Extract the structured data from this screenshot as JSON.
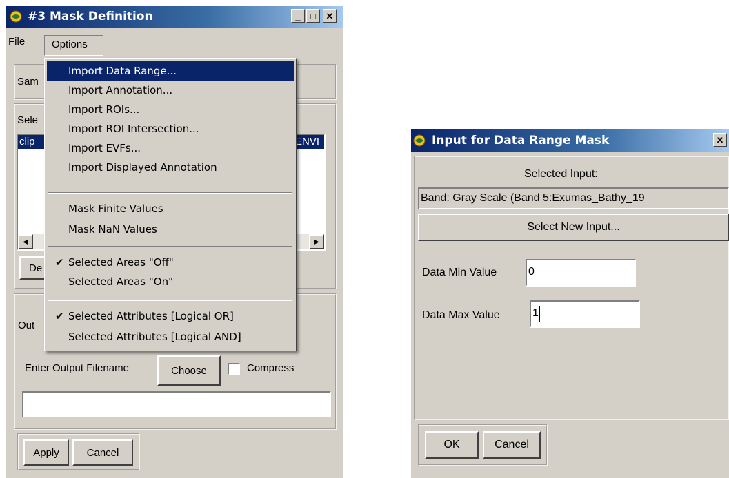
{
  "mask_window": {
    "title": "#3 Mask Definition",
    "menubar": [
      "File",
      "Options"
    ],
    "sample_label": "Sam",
    "select_label": "Sele",
    "list_item": "clip",
    "list_item_right": "ENVI",
    "define_button": "De",
    "output_label": "Out",
    "enter_output_label": "Enter Output Filename",
    "choose_button": "Choose",
    "compress_label": "Compress",
    "output_filename": "",
    "apply_button": "Apply",
    "cancel_button": "Cancel"
  },
  "options_menu": {
    "items": [
      {
        "label": "Import Data Range...",
        "highlighted": true,
        "checked": false
      },
      {
        "label": "Import Annotation...",
        "checked": false
      },
      {
        "label": "Import ROIs...",
        "checked": false
      },
      {
        "label": "Import ROI Intersection...",
        "checked": false
      },
      {
        "label": "Import EVFs...",
        "checked": false
      },
      {
        "label": "Import Displayed Annotation",
        "checked": false
      },
      {
        "label": "Mask Finite Values",
        "checked": false
      },
      {
        "label": "Mask NaN Values",
        "checked": false
      },
      {
        "label": "Selected Areas \"Off\"",
        "checked": true
      },
      {
        "label": "Selected Areas \"On\"",
        "checked": false
      },
      {
        "label": "Selected Attributes [Logical OR]",
        "checked": true
      },
      {
        "label": "Selected Attributes [Logical AND]",
        "checked": false
      }
    ],
    "check_glyph": "✔"
  },
  "input_dialog": {
    "title": "Input for Data Range Mask",
    "selected_input_label": "Selected Input:",
    "selected_input_value": "Band: Gray Scale (Band 5:Exumas_Bathy_19",
    "select_new_input_button": "Select New Input...",
    "data_min_label": "Data Min Value",
    "data_min_value": "0",
    "data_max_label": "Data Max Value",
    "data_max_value": "1",
    "ok_button": "OK",
    "cancel_button": "Cancel"
  },
  "colors": {
    "titlebar_start": "#0a246a",
    "titlebar_end": "#a6caf0",
    "window_bg": "#d4d0c8",
    "menu_highlight": "#0a246a"
  },
  "icons": {
    "app_icon": "envi-globe-icon",
    "minimize": "minimize-icon",
    "maximize": "maximize-icon",
    "close": "close-icon",
    "scroll_left": "scroll-left-arrow-icon",
    "scroll_right": "scroll-right-arrow-icon"
  }
}
